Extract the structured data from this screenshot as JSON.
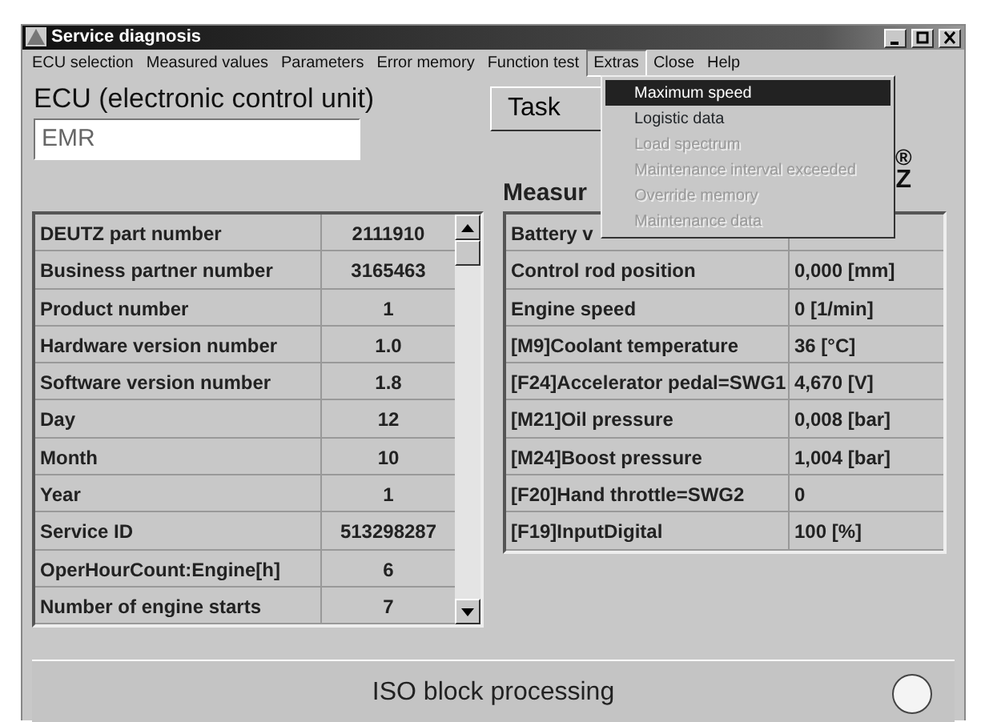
{
  "window": {
    "title": "Service diagnosis"
  },
  "menu_bar": [
    {
      "label": "ECU selection",
      "open": false
    },
    {
      "label": "Measured values",
      "open": false
    },
    {
      "label": "Parameters",
      "open": false
    },
    {
      "label": "Error memory",
      "open": false
    },
    {
      "label": "Function test",
      "open": false
    },
    {
      "label": "Extras",
      "open": true
    },
    {
      "label": "Close",
      "open": false
    },
    {
      "label": "Help",
      "open": false
    }
  ],
  "extras_menu": [
    {
      "label": "Maximum speed",
      "selected": true,
      "disabled": false
    },
    {
      "label": "Logistic data",
      "selected": false,
      "disabled": false
    },
    {
      "label": "Load spectrum",
      "selected": false,
      "disabled": true
    },
    {
      "label": "Maintenance interval exceeded",
      "selected": false,
      "disabled": true
    },
    {
      "label": "Override memory",
      "selected": false,
      "disabled": true
    },
    {
      "label": "Maintenance data",
      "selected": false,
      "disabled": true
    }
  ],
  "ecu": {
    "heading": "ECU (electronic control unit)",
    "value": "EMR"
  },
  "task_button": "Task",
  "logo": {
    "mark": "®",
    "letter": "Z"
  },
  "ecu_info": [
    {
      "label": "DEUTZ part number",
      "value": "2111910"
    },
    {
      "label": "Business partner number",
      "value": "3165463"
    },
    {
      "label": "Product number",
      "value": "1"
    },
    {
      "label": "Hardware version number",
      "value": "1.0"
    },
    {
      "label": "Software version number",
      "value": "1.8"
    },
    {
      "label": "Day",
      "value": "12"
    },
    {
      "label": "Month",
      "value": "10"
    },
    {
      "label": "Year",
      "value": "1"
    },
    {
      "label": "Service ID",
      "value": "513298287"
    },
    {
      "label": "OperHourCount:Engine[h]",
      "value": "6"
    },
    {
      "label": "Number of engine starts",
      "value": "7"
    }
  ],
  "measured_values": {
    "heading": "Measur",
    "rows": [
      {
        "label": "Battery v",
        "value": ""
      },
      {
        "label": "Control rod position",
        "value": "0,000 [mm]"
      },
      {
        "label": "Engine speed",
        "value": "0 [1/min]"
      },
      {
        "label": "[M9]Coolant temperature",
        "value": "36 [°C]"
      },
      {
        "label": "[F24]Accelerator pedal=SWG1",
        "value": "4,670 [V]"
      },
      {
        "label": "[M21]Oil pressure",
        "value": "0,008 [bar]"
      },
      {
        "label": "[M24]Boost pressure",
        "value": "1,004 [bar]"
      },
      {
        "label": "[F20]Hand throttle=SWG2",
        "value": "0"
      },
      {
        "label": "[F19]InputDigital",
        "value": "100 [%]"
      }
    ]
  },
  "status_bar": {
    "text": "ISO block processing",
    "indicator_on": false
  }
}
